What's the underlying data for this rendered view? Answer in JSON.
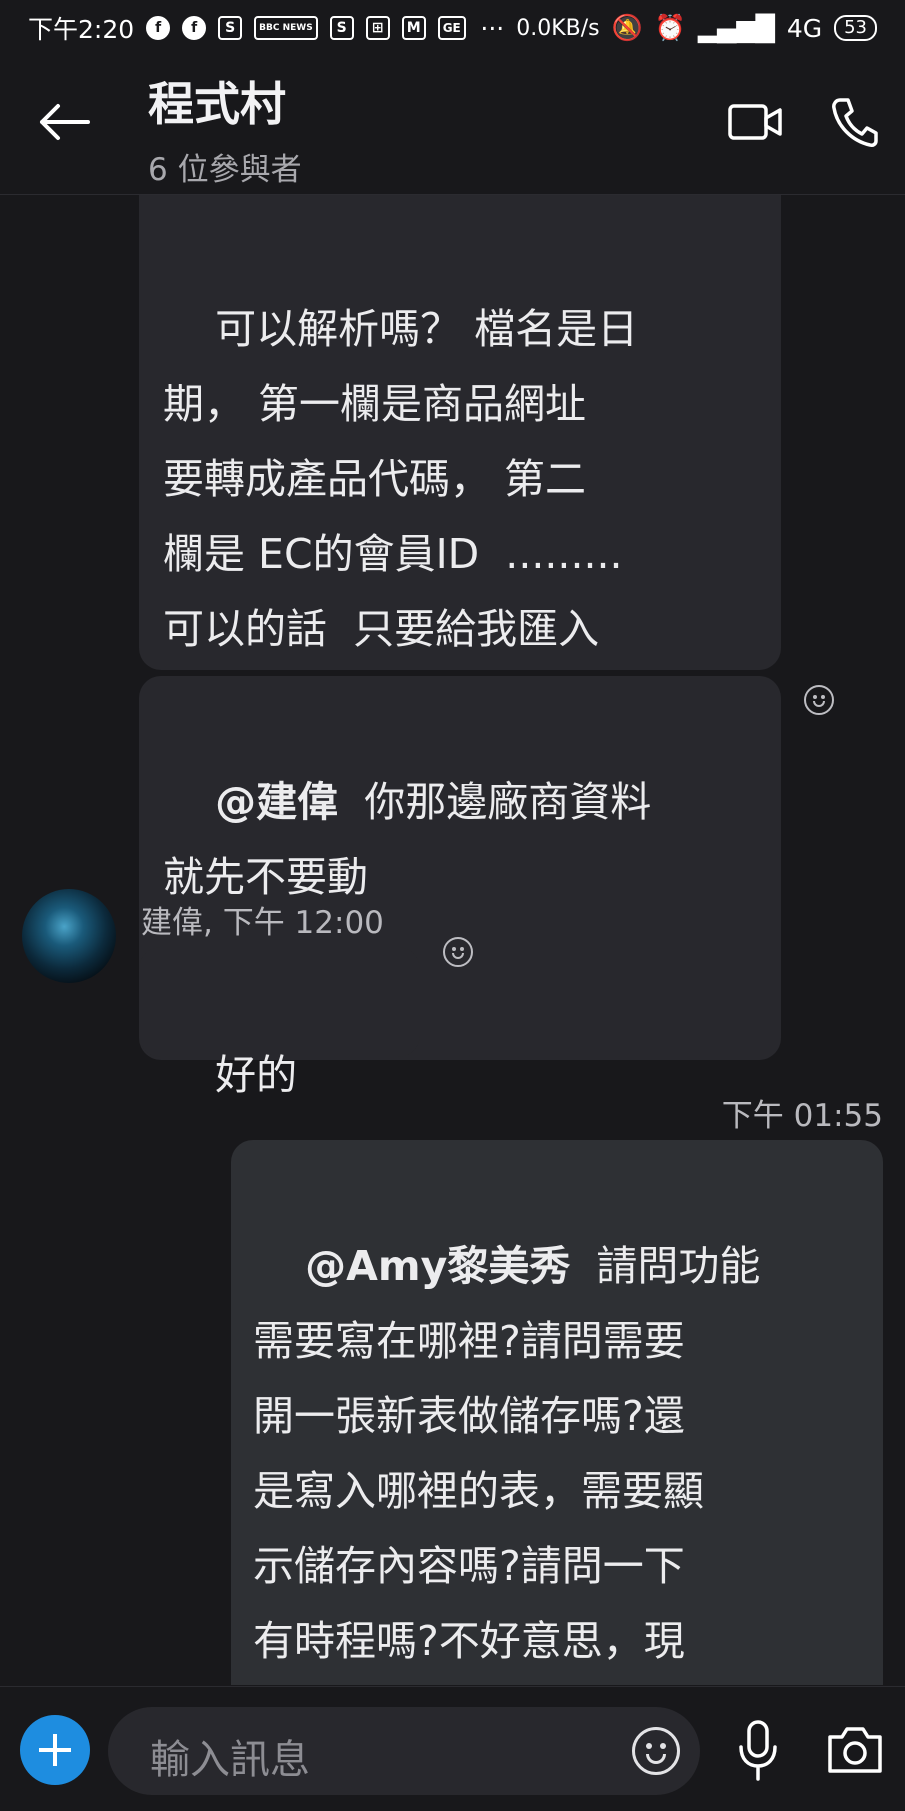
{
  "status_bar": {
    "time": "下午2:20",
    "notifications": [
      "facebook-icon",
      "facebook-icon",
      "shopee-icon",
      "bbc-news-icon",
      "shopee-icon",
      "grid-icon",
      "gmail-icon",
      "ge-icon"
    ],
    "bbc_text": "BBC NEWS",
    "ge_text": "GE",
    "more": "···",
    "net_speed": "0.0KB/s",
    "network": "4G",
    "battery": "53"
  },
  "header": {
    "title": "程式村",
    "subtitle": "6 位參與者"
  },
  "messages": [
    {
      "direction": "incoming",
      "text": "可以解析嗎？ 檔名是日\n期， 第一欄是商品網址\n要轉成產品代碼， 第二\n欄是 EC的會員ID  .........\n可以的話  只要給我匯入\n功能就好"
    },
    {
      "direction": "incoming",
      "mention": "@建偉",
      "text": "  你那邊廠商資料\n就先不要動"
    },
    {
      "direction": "incoming",
      "sender": "建偉, 下午 12:00",
      "text": "好的"
    },
    {
      "direction": "outgoing",
      "time": "下午 01:55",
      "mention": "@Amy黎美秀",
      "text": "  請問功能\n需要寫在哪裡?請問需要\n開一張新表做儲存嗎?還\n是寫入哪裡的表，需要顯\n示儲存內容嗎?請問一下\n有時程嗎?不好意思，現\n在在做精技購物中心不"
    }
  ],
  "composer": {
    "placeholder": "輸入訊息"
  },
  "colors": {
    "background": "#18181b",
    "bubble_incoming": "#28282d",
    "bubble_outgoing": "#2e3034",
    "accent": "#1e8de0"
  }
}
